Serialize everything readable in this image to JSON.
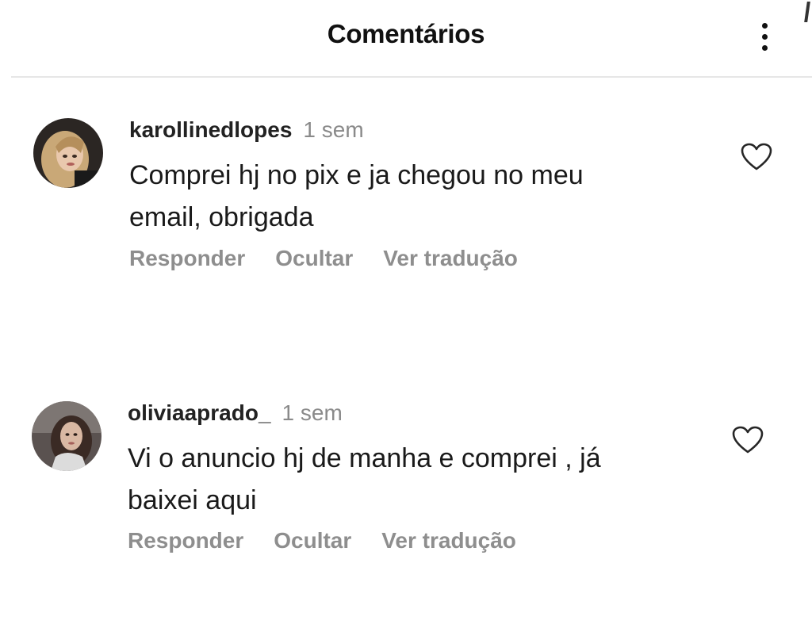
{
  "header": {
    "title": "Comentários",
    "more_icon": "more-vertical-icon"
  },
  "comments": [
    {
      "username": "karollinedlopes",
      "time": "1 sem",
      "text_line1": "Comprei hj no pix e ja chegou no meu",
      "text_line2": "email, obrigada",
      "actions": {
        "reply": "Responder",
        "hide": "Ocultar",
        "translate": "Ver tradução"
      },
      "like_icon": "heart-icon"
    },
    {
      "username": "oliviaaprado_",
      "time": "1 sem",
      "text_line1": "Vi o anuncio hj de manha e comprei , já",
      "text_line2": "baixei aqui",
      "actions": {
        "reply": "Responder",
        "hide": "Ocultar",
        "translate": "Ver tradução"
      },
      "like_icon": "heart-icon"
    }
  ],
  "colors": {
    "text_primary": "#111111",
    "text_secondary": "#8e8e8e",
    "divider": "#e6e6e6",
    "background": "#ffffff"
  }
}
